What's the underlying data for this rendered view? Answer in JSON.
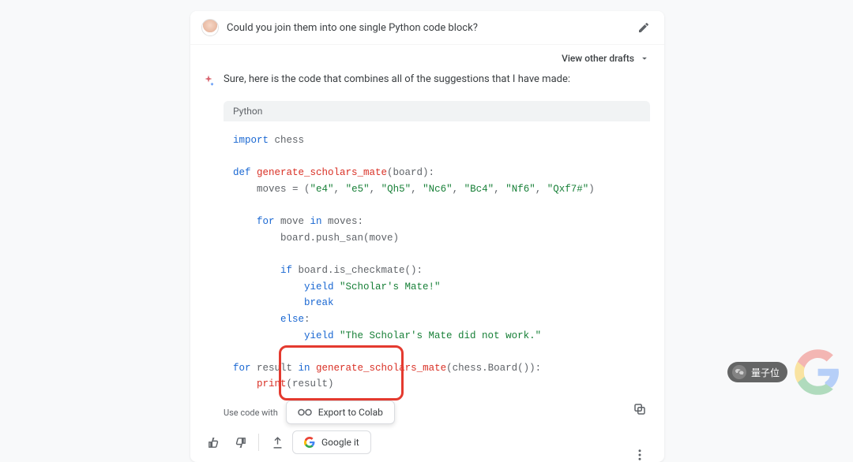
{
  "prompt": "Could you join them into one single Python code block?",
  "view_drafts": "View other drafts",
  "answer_intro": "Sure, here is the code that combines all of the suggestions that I have made:",
  "code_lang": "Python",
  "code_lines": [
    [
      {
        "t": "import ",
        "c": "kw"
      },
      {
        "t": "chess",
        "c": "plain"
      }
    ],
    [],
    [
      {
        "t": "def ",
        "c": "kw"
      },
      {
        "t": "generate_scholars_mate",
        "c": "fn"
      },
      {
        "t": "(board):",
        "c": "plain"
      }
    ],
    [
      {
        "t": "    moves = (",
        "c": "plain"
      },
      {
        "t": "\"e4\"",
        "c": "str"
      },
      {
        "t": ", ",
        "c": "plain"
      },
      {
        "t": "\"e5\"",
        "c": "str"
      },
      {
        "t": ", ",
        "c": "plain"
      },
      {
        "t": "\"Qh5\"",
        "c": "str"
      },
      {
        "t": ", ",
        "c": "plain"
      },
      {
        "t": "\"Nc6\"",
        "c": "str"
      },
      {
        "t": ", ",
        "c": "plain"
      },
      {
        "t": "\"Bc4\"",
        "c": "str"
      },
      {
        "t": ", ",
        "c": "plain"
      },
      {
        "t": "\"Nf6\"",
        "c": "str"
      },
      {
        "t": ", ",
        "c": "plain"
      },
      {
        "t": "\"Qxf7#\"",
        "c": "str"
      },
      {
        "t": ")",
        "c": "plain"
      }
    ],
    [],
    [
      {
        "t": "    for ",
        "c": "kw"
      },
      {
        "t": "move ",
        "c": "plain"
      },
      {
        "t": "in ",
        "c": "kw"
      },
      {
        "t": "moves:",
        "c": "plain"
      }
    ],
    [
      {
        "t": "        board.push_san(move)",
        "c": "plain"
      }
    ],
    [],
    [
      {
        "t": "        if ",
        "c": "kw"
      },
      {
        "t": "board.is_checkmate():",
        "c": "plain"
      }
    ],
    [
      {
        "t": "            yield ",
        "c": "kw"
      },
      {
        "t": "\"Scholar's Mate!\"",
        "c": "str"
      }
    ],
    [
      {
        "t": "            break",
        "c": "kw"
      }
    ],
    [
      {
        "t": "        else",
        "c": "kw"
      },
      {
        "t": ":",
        "c": "plain"
      }
    ],
    [
      {
        "t": "            yield ",
        "c": "kw"
      },
      {
        "t": "\"The Scholar's Mate did not work.\"",
        "c": "str"
      }
    ],
    [],
    [
      {
        "t": "for ",
        "c": "kw"
      },
      {
        "t": "result ",
        "c": "plain"
      },
      {
        "t": "in ",
        "c": "kw"
      },
      {
        "t": "generate_scholars_mate",
        "c": "fn"
      },
      {
        "t": "(chess.Board()):",
        "c": "plain"
      }
    ],
    [
      {
        "t": "    print",
        "c": "fn"
      },
      {
        "t": "(result)",
        "c": "plain"
      }
    ]
  ],
  "use_code_label": "Use code with",
  "export_label": "Export to Colab",
  "google_it_label": "Google it",
  "watermark_text": "量子位"
}
